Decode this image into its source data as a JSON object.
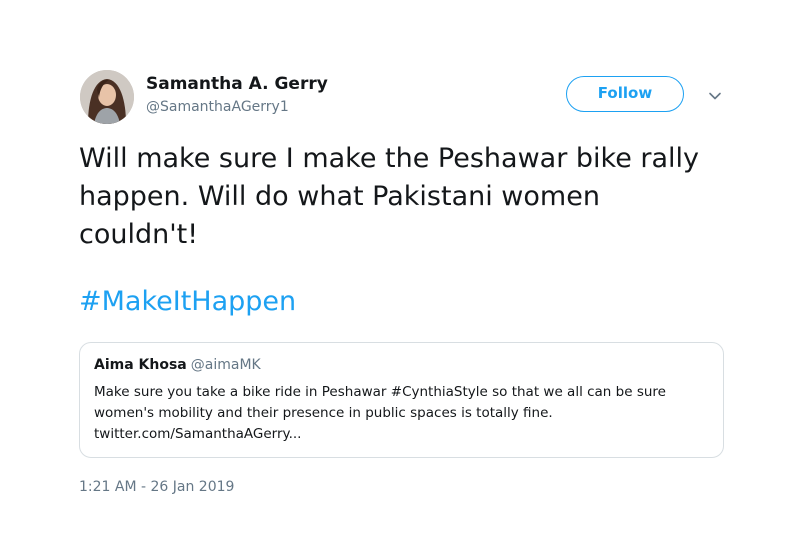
{
  "author": {
    "display_name": "Samantha A. Gerry",
    "handle": "@SamanthaAGerry1"
  },
  "follow_button": {
    "label": "Follow"
  },
  "menu": {
    "icon": "chevron-down-icon"
  },
  "tweet": {
    "text_lines": [
      "Will make sure I make the Peshawar bike rally",
      "happen. Will do what Pakistani women",
      "couldn't!"
    ],
    "hashtag": "#MakeItHappen",
    "timestamp": "1:21 AM - 26 Jan 2019"
  },
  "quoted_tweet": {
    "display_name": "Aima Khosa",
    "handle": "@aimaMK",
    "text_lines": [
      "Make sure you take a bike ride in Peshawar #CynthiaStyle so that we all can be sure",
      "women's mobility and their presence in public spaces is totally fine.",
      "twitter.com/SamanthaAGerry..."
    ]
  },
  "colors": {
    "accent": "#1da1f2",
    "text_primary": "#14171a",
    "text_secondary": "#657786",
    "border": "#d8dee2"
  }
}
